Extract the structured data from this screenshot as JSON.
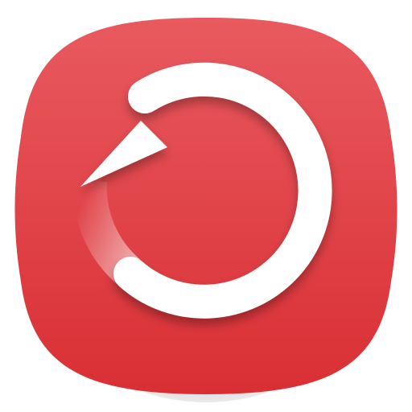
{
  "app_icon": {
    "icon_name": "refresh-icon",
    "colors": {
      "tile_top": "#e85a5f",
      "tile_bottom": "#d92f34",
      "glyph": "#ffffff"
    }
  }
}
